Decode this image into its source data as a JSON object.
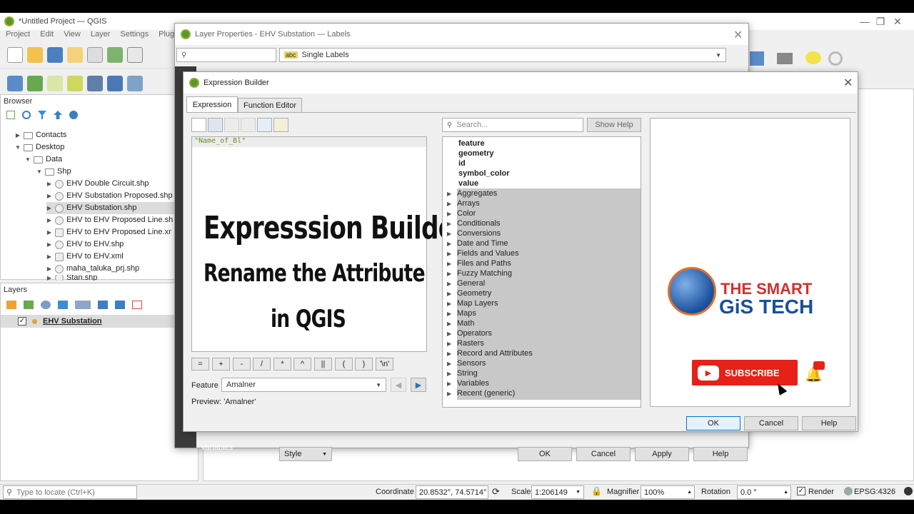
{
  "qgis_window": {
    "title": "*Untitled Project — QGIS",
    "menu": [
      "Project",
      "Edit",
      "View",
      "Layer",
      "Settings",
      "Plugi"
    ]
  },
  "browser": {
    "title": "Browser",
    "items": [
      {
        "label": "Contacts"
      },
      {
        "label": "Desktop"
      },
      {
        "label": "Data"
      },
      {
        "label": "Shp"
      },
      {
        "label": "EHV Double Circuit.shp"
      },
      {
        "label": "EHV Substation Proposed.shp"
      },
      {
        "label": "EHV Substation.shp"
      },
      {
        "label": "EHV to EHV Proposed Line.sh"
      },
      {
        "label": "EHV to EHV Proposed Line.xr"
      },
      {
        "label": "EHV to EHV.shp"
      },
      {
        "label": "EHV to EHV.xml"
      },
      {
        "label": "maha_taluka_prj.shp"
      },
      {
        "label": "Stan.shp"
      }
    ]
  },
  "layers": {
    "title": "Layers",
    "items": [
      {
        "label": "EHV Substation"
      }
    ]
  },
  "layer_properties": {
    "title": "Layer Properties - EHV Substation — Labels",
    "label_mode": "Single Labels",
    "side_variables": "Variables",
    "buttons": {
      "style": "Style",
      "ok": "OK",
      "cancel": "Cancel",
      "apply": "Apply",
      "help": "Help"
    }
  },
  "expression_builder": {
    "title": "Expression Builder",
    "tabs": [
      "Expression",
      "Function Editor"
    ],
    "expression_text": "\"Name_of_Bl\"",
    "operators": [
      "=",
      "+",
      "-",
      "/",
      "*",
      "^",
      "||",
      "(",
      ")",
      "'\\n'"
    ],
    "feature_label": "Feature",
    "feature_value": "Amalner",
    "preview": "Preview:  'Amalner'",
    "search_placeholder": "Search...",
    "show_help": "Show Help",
    "fields": [
      "feature",
      "geometry",
      "id",
      "symbol_color",
      "value"
    ],
    "groups": [
      "Aggregates",
      "Arrays",
      "Color",
      "Conditionals",
      "Conversions",
      "Date and Time",
      "Fields and Values",
      "Files and Paths",
      "Fuzzy Matching",
      "General",
      "Geometry",
      "Map Layers",
      "Maps",
      "Math",
      "Operators",
      "Rasters",
      "Record and Attributes",
      "Sensors",
      "String",
      "Variables",
      "Recent (generic)"
    ],
    "buttons": {
      "ok": "OK",
      "cancel": "Cancel",
      "help": "Help"
    }
  },
  "overlay": {
    "line1": "Expresssion Builder",
    "line2": "Rename the Attribute",
    "line3": "in QGIS"
  },
  "branding": {
    "line1": "THE SMART",
    "line2": "GiS TECH",
    "subscribe": "SUBSCRIBE"
  },
  "statusbar": {
    "locate_placeholder": "Type to locate (Ctrl+K)",
    "coordinate_label": "Coordinate",
    "coordinate_value": "20.8532°, 74.5714°",
    "scale_label": "Scale",
    "scale_value": "1:206149",
    "magnifier_label": "Magnifier",
    "magnifier_value": "100%",
    "rotation_label": "Rotation",
    "rotation_value": "0.0 °",
    "render_label": "Render",
    "crs": "EPSG:4326"
  },
  "colors": {
    "accent": "#0078d7",
    "subscribe_red": "#e62117",
    "brand_red": "#d0312d",
    "brand_blue": "#1a4f9c",
    "qgis_green": "#589632"
  }
}
